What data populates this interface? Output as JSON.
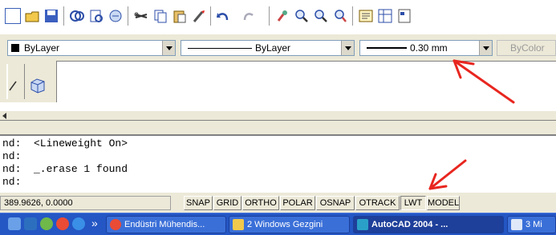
{
  "toolbar": {
    "icons": [
      "new-icon",
      "open-icon",
      "save-icon",
      "print-icon",
      "plot-preview-icon",
      "publish-icon",
      "cut-icon",
      "copy-icon",
      "paste-icon",
      "match-properties-icon",
      "undo-icon",
      "redo-icon",
      "pan-icon",
      "zoom-realtime-icon",
      "zoom-window-icon",
      "zoom-previous-icon",
      "properties-icon",
      "design-center-icon",
      "tool-palettes-icon"
    ]
  },
  "properties_bar": {
    "color_value": "ByLayer",
    "linetype_value": "ByLayer",
    "lineweight_value": "0.30 mm",
    "plotstyle_value": "ByColor"
  },
  "command_history": {
    "lines": [
      "nd:  <Lineweight On>",
      "nd:",
      "nd:  _.erase 1 found",
      "nd:"
    ]
  },
  "status_bar": {
    "coords": "389.9626, 0.0000",
    "toggles": [
      {
        "label": "SNAP",
        "on": false
      },
      {
        "label": "GRID",
        "on": false
      },
      {
        "label": "ORTHO",
        "on": false
      },
      {
        "label": "POLAR",
        "on": false
      },
      {
        "label": "OSNAP",
        "on": false
      },
      {
        "label": "OTRACK",
        "on": false
      },
      {
        "label": "LWT",
        "on": true
      },
      {
        "label": "MODEL",
        "on": false
      }
    ]
  },
  "taskbar": {
    "overflow": "»",
    "tasks": [
      {
        "label": "Endüstri Mühendis...",
        "icon": "chrome-icon",
        "active": false
      },
      {
        "label": "2 Windows Gezgini",
        "icon": "folder-icon",
        "active": false
      },
      {
        "label": "AutoCAD 2004 - ...",
        "icon": "autocad-icon",
        "active": true
      },
      {
        "label": "3 Mi",
        "icon": "word-icon",
        "active": false
      }
    ]
  },
  "colors": {
    "annotation": "#e8261f",
    "taskbar": "#2456c4"
  }
}
